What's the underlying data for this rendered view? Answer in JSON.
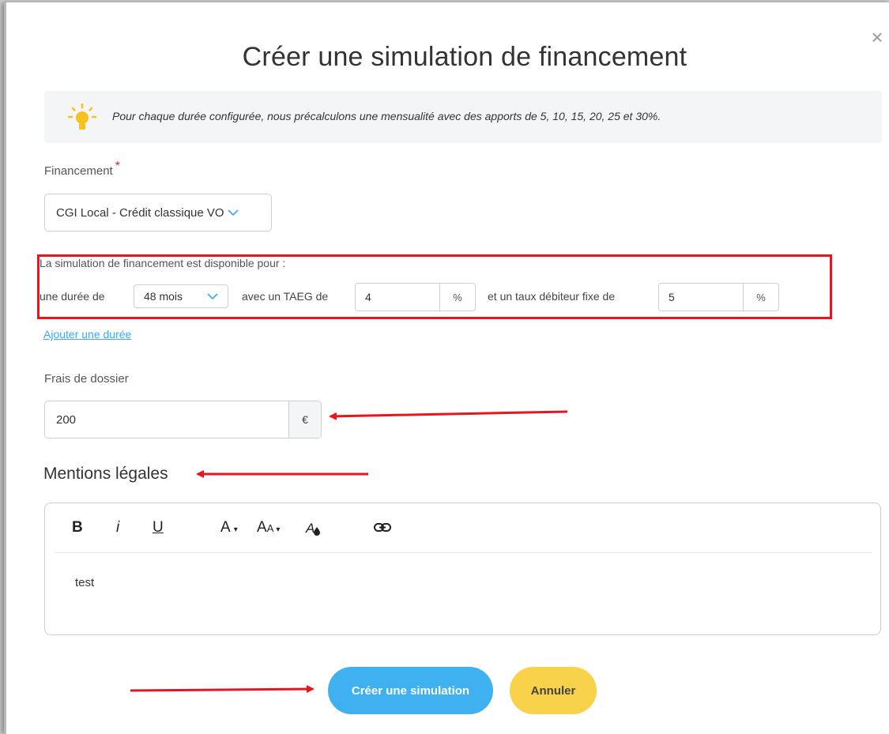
{
  "modal": {
    "title": "Créer une simulation de financement",
    "close_icon": "close-icon"
  },
  "info": {
    "icon": "lightbulb-icon",
    "text": "Pour chaque durée configurée, nous précalculons une mensualité avec des apports de 5, 10, 15, 20, 25 et 30%."
  },
  "financement": {
    "label": "Financement",
    "required_mark": "*",
    "selected": "CGI Local - Crédit classique VO",
    "chevron_icon": "chevron-down-icon"
  },
  "simulation": {
    "intro": "La simulation de financement est disponible pour :",
    "duree_prefix": "une durée de",
    "duree_value": "48 mois",
    "taeg_label": "avec un TAEG de",
    "taeg_value": "4",
    "taeg_unit": "%",
    "taux_label": "et un taux débiteur fixe de",
    "taux_value": "5",
    "taux_unit": "%"
  },
  "add_duration_link": "Ajouter une durée",
  "frais": {
    "label": "Frais de dossier",
    "value": "200",
    "unit": "€"
  },
  "mentions": {
    "title": "Mentions légales",
    "toolbar": {
      "bold": "B",
      "italic": "i",
      "underline": "U",
      "font": "A",
      "size_a": "A",
      "size_small": "A",
      "caret": "▾"
    },
    "content": "test"
  },
  "buttons": {
    "create": "Créer une simulation",
    "cancel": "Annuler"
  },
  "colors": {
    "accent_blue": "#3fb0f0",
    "cancel_yellow": "#f7d24a",
    "annotation_red": "#e8141e"
  }
}
